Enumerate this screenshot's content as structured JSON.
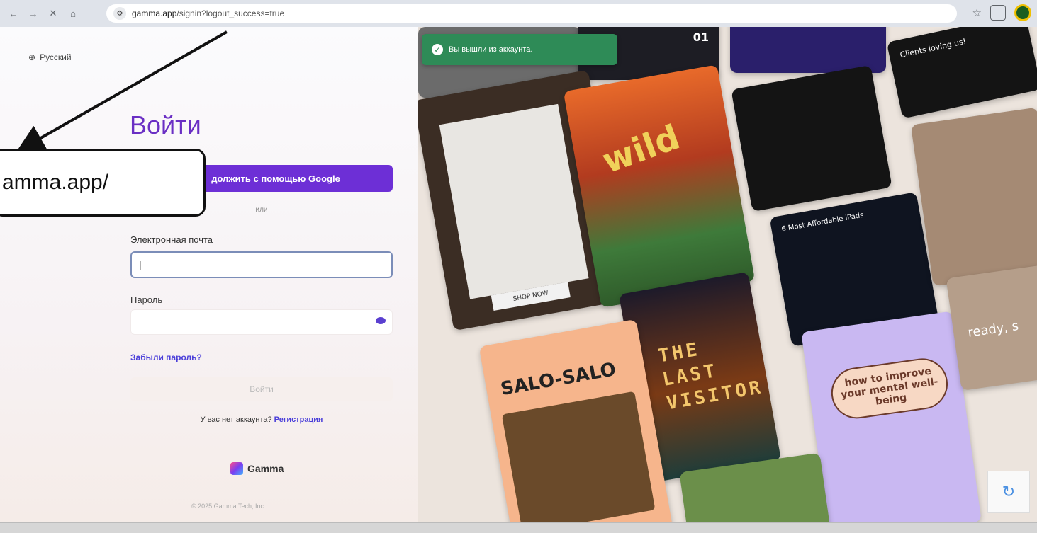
{
  "browser": {
    "url_host": "gamma.app",
    "url_path": "/signin?logout_success=true"
  },
  "language": "Русский",
  "signin": {
    "title": "Войти",
    "google_button": "должить с помощью Google",
    "or": "или",
    "email_label": "Электронная почта",
    "email_value": "|",
    "password_label": "Пароль",
    "forgot": "Забыли пароль?",
    "submit": "Войти",
    "no_account": "У вас нет аккаунта?",
    "register": "Регистрация",
    "logo_text": "Gamma",
    "copyright": "© 2025 Gamma Tech, Inc."
  },
  "callout": {
    "text": "amma.app/"
  },
  "toast": {
    "text": "Вы вышли из аккаунта."
  },
  "gallery": {
    "wild": "wild",
    "poster_lines": [
      "THE",
      "LAST",
      "VISITOR"
    ],
    "salo": "SALO-SALO",
    "card_01": "01",
    "mental": "how to improve your mental well-being",
    "ipads": "6 Most Affordable iPads",
    "shop_now": "SHOP NOW",
    "ready": "ready, s",
    "clients": "Clients loving us!"
  },
  "colors": {
    "accent": "#6d2fd6",
    "link": "#4b3fd9",
    "toast": "#2e8b57"
  }
}
